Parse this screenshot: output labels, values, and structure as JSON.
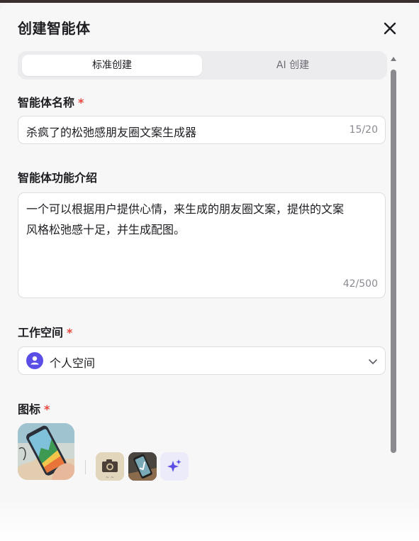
{
  "modal": {
    "title": "创建智能体"
  },
  "tabs": [
    {
      "label": "标准创建",
      "active": true
    },
    {
      "label": "AI 创建",
      "active": false
    }
  ],
  "name_field": {
    "label": "智能体名称",
    "required_mark": "*",
    "value": "杀疯了的松弛感朋友圈文案生成器",
    "counter": "15/20"
  },
  "desc_field": {
    "label": "智能体功能介绍",
    "value_lines": [
      "一个可以根据用户提供心情，来生成的朋友圈文案，提供的文案",
      "风格松弛感十足，并生成配图。"
    ],
    "counter": "42/500"
  },
  "workspace_field": {
    "label": "工作空间",
    "required_mark": "*",
    "value": "个人空间",
    "avatar_icon": "user-icon"
  },
  "icon_field": {
    "label": "图标",
    "required_mark": "*",
    "options": [
      "phone-landscape-photo",
      "camera-sticker",
      "phone-checkmark-photo",
      "sparkle-icon"
    ]
  },
  "colors": {
    "accent": "#5b4ee6",
    "required": "#e5483b",
    "background": "#f7f7f8"
  }
}
